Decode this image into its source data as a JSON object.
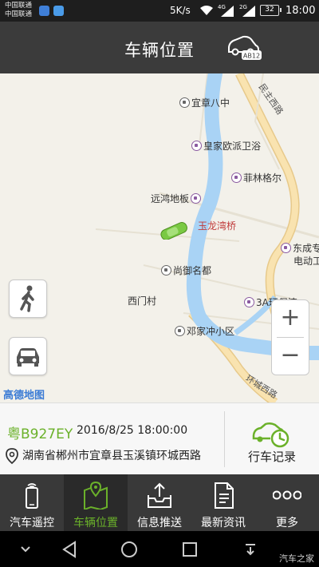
{
  "status_bar": {
    "carrier_1": "中国联通",
    "carrier_2": "中国联通",
    "network_speed": "5K/s",
    "network_1": "4G",
    "network_2": "2G",
    "battery": "32",
    "time": "18:00"
  },
  "header": {
    "title": "车辆位置",
    "car_badge": "AB12"
  },
  "map": {
    "pois": [
      "宜章八中",
      "皇家欧派卫浴",
      "菲林格尔",
      "远鸿地板",
      "玉龙湾桥",
      "尚御名都",
      "西门村",
      "3A环保漆",
      "邓家冲小区",
      "东成专",
      "电动工"
    ],
    "roads": [
      "民主西路",
      "环城西路"
    ],
    "logo": "高德地图",
    "zoom_in": "+",
    "zoom_out": "−",
    "colors": {
      "river": "#a9d3f5",
      "road": "#f9e3b0",
      "vehicle": "#7ac943",
      "logo": "#3a7bd5"
    }
  },
  "vehicle": {
    "plate": "粤B927EY",
    "datetime": "2016/8/25 18:00:00",
    "address": "湖南省郴州市宜章县玉溪镇环城西路"
  },
  "trip_record": {
    "label": "行车记录"
  },
  "tabs": [
    {
      "label": "汽车遥控",
      "icon": "phone-remote-icon",
      "active": false
    },
    {
      "label": "车辆位置",
      "icon": "map-pin-icon",
      "active": true
    },
    {
      "label": "信息推送",
      "icon": "inbox-upload-icon",
      "active": false
    },
    {
      "label": "最新资讯",
      "icon": "document-icon",
      "active": false
    },
    {
      "label": "更多",
      "icon": "more-dots-icon",
      "active": false
    }
  ],
  "accent_color": "#6bb12a",
  "watermark": "汽车之家"
}
